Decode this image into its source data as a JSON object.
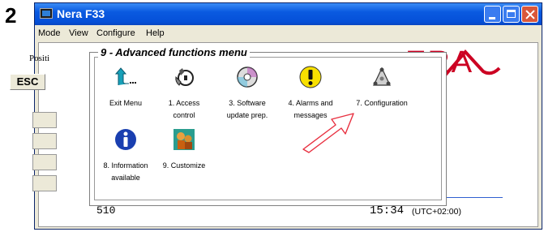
{
  "step": "2",
  "window": {
    "title": "Nera F33"
  },
  "menubar": {
    "items": [
      "Mode",
      "View",
      "Configure",
      "Help"
    ]
  },
  "main": {
    "position_label": "Positi",
    "esc_label": "ESC",
    "logo_text": "ERA",
    "logo_color": "#cc0022",
    "status": {
      "number": "510",
      "time": "15:34",
      "timezone": "(UTC+02:00)"
    }
  },
  "advanced_menu": {
    "title": "9 - Advanced functions menu",
    "items": [
      {
        "label1": "Exit Menu",
        "label2": "",
        "icon": "exit-arrow-icon"
      },
      {
        "label1": "1.  Access",
        "label2": "control",
        "icon": "access-control-icon"
      },
      {
        "label1": "3.  Software",
        "label2": "update prep.",
        "icon": "cd-disc-icon"
      },
      {
        "label1": "4.  Alarms and",
        "label2": "messages",
        "icon": "alarm-exclamation-icon"
      },
      {
        "label1": "7.  Configuration",
        "label2": "",
        "icon": "configuration-icon"
      },
      {
        "label1": "8.  Information",
        "label2": "available",
        "icon": "information-icon"
      },
      {
        "label1": "9.  Customize",
        "label2": "",
        "icon": "customize-icon"
      }
    ]
  },
  "colors": {
    "titlebar": "#0550d8",
    "accent_arrow": "#e83040",
    "info_blue": "#1a3fb0",
    "alarm_yellow": "#f8e000"
  }
}
